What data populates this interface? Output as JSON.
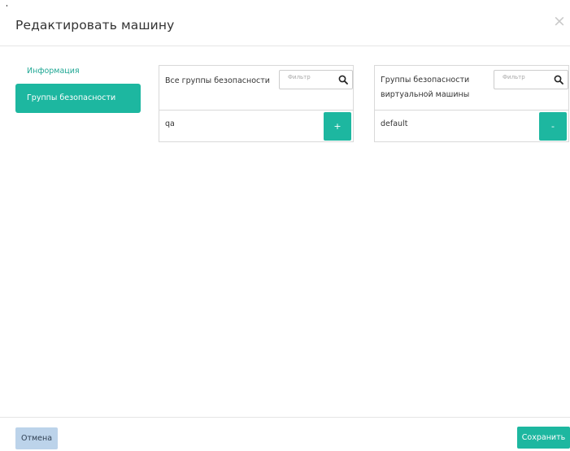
{
  "dialog": {
    "title": "Редактировать машину",
    "close_glyph": "×"
  },
  "nav": {
    "items": [
      {
        "label": "Информация",
        "active": false
      },
      {
        "label": "Группы безопасности",
        "active": true
      }
    ]
  },
  "available": {
    "title": "Все группы безопасности",
    "filter_placeholder": "Фильтр",
    "items": [
      {
        "name": "qa",
        "action": "+"
      }
    ]
  },
  "allocated": {
    "title_line1": "Группы безопасности",
    "title_line2": "виртуальной машины",
    "filter_placeholder": "Фильтр",
    "items": [
      {
        "name": "default",
        "action": "-"
      }
    ]
  },
  "footer": {
    "cancel_label": "Отмена",
    "save_label": "Сохранить"
  },
  "colors": {
    "accent": "#1db7a0",
    "link": "#1fa794",
    "cancel_bg": "#bcd3ea"
  },
  "icons": {
    "close": "close-icon",
    "search": "search-icon"
  }
}
